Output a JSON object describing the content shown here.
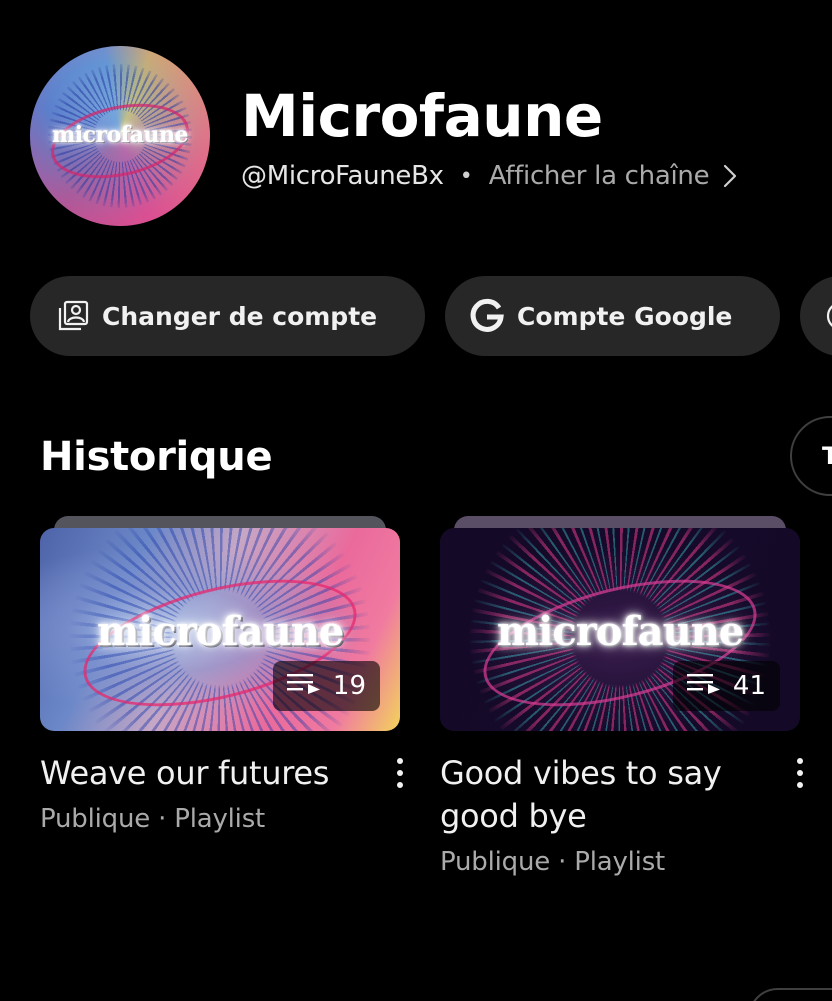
{
  "channel": {
    "name": "Microfaune",
    "handle": "@MicroFauneBx",
    "separator": "•",
    "view_channel_label": "Afficher la chaîne",
    "avatar_logo": "microfaune"
  },
  "actions": [
    {
      "label": "Changer de compte",
      "icon": "switch-account-icon"
    },
    {
      "label": "Compte Google",
      "icon": "google-g-icon"
    },
    {
      "label": "",
      "icon": "incognito-icon"
    }
  ],
  "history": {
    "title": "Historique",
    "see_all_label": "T",
    "items": [
      {
        "title": "Weave our futures",
        "meta": "Publique · Playlist",
        "count": "19",
        "thumb_logo": "microfaune"
      },
      {
        "title": "Good vibes to say good bye",
        "meta": "Publique · Playlist",
        "count": "41",
        "thumb_logo": "microfaune"
      }
    ]
  },
  "colors": {
    "background": "#000000",
    "chip_bg": "#272727",
    "secondary_text": "#aaaaaa"
  }
}
